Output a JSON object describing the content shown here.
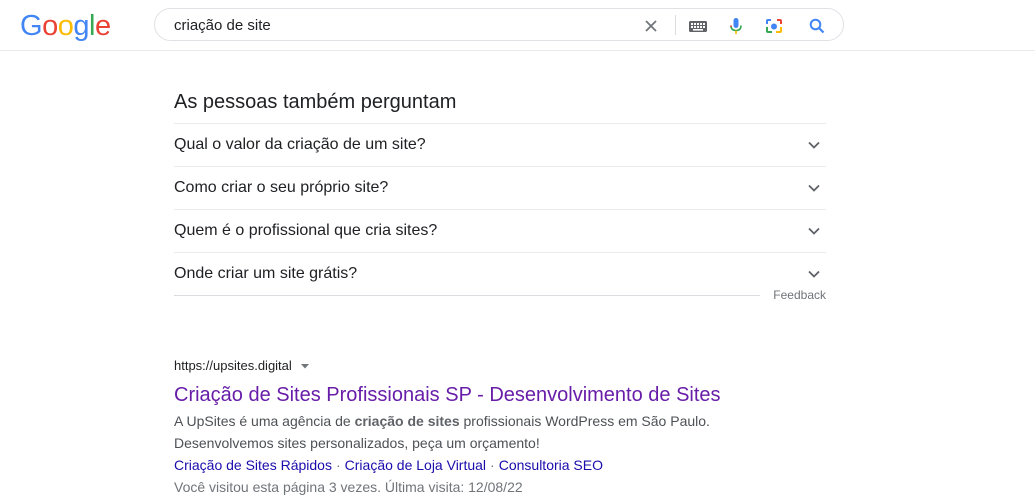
{
  "header": {
    "logo_letters": [
      {
        "ch": "G",
        "color": "#4285F4"
      },
      {
        "ch": "o",
        "color": "#EA4335"
      },
      {
        "ch": "o",
        "color": "#FBBC05"
      },
      {
        "ch": "g",
        "color": "#4285F4"
      },
      {
        "ch": "l",
        "color": "#34A853"
      },
      {
        "ch": "e",
        "color": "#EA4335"
      }
    ],
    "search_value": "criação de site",
    "icons": [
      "clear-icon",
      "keyboard-icon",
      "microphone-icon",
      "camera-icon",
      "search-icon"
    ]
  },
  "paa": {
    "title": "As pessoas também perguntam",
    "questions": [
      "Qual o valor da criação de um site?",
      "Como criar o seu próprio site?",
      "Quem é o profissional que cria sites?",
      "Onde criar um site grátis?"
    ],
    "feedback": "Feedback"
  },
  "result": {
    "url": "https://upsites.digital",
    "title": "Criação de Sites Profissionais SP - Desenvolvimento de Sites",
    "snippet_before": "A UpSites é uma agência de ",
    "snippet_bold": "criação de sites",
    "snippet_after": " profissionais WordPress em São Paulo.",
    "snippet_line2": "Desenvolvemos sites personalizados, peça um orçamento!",
    "sitelinks": [
      "Criação de Sites Rápidos",
      "Criação de Loja Virtual",
      "Consultoria SEO"
    ],
    "visited": "Você visitou esta página 3 vezes. Última visita: 12/08/22"
  },
  "colors": {
    "link_visited": "#681da8",
    "link": "#1a0dab",
    "snippet": "#4d5156"
  }
}
